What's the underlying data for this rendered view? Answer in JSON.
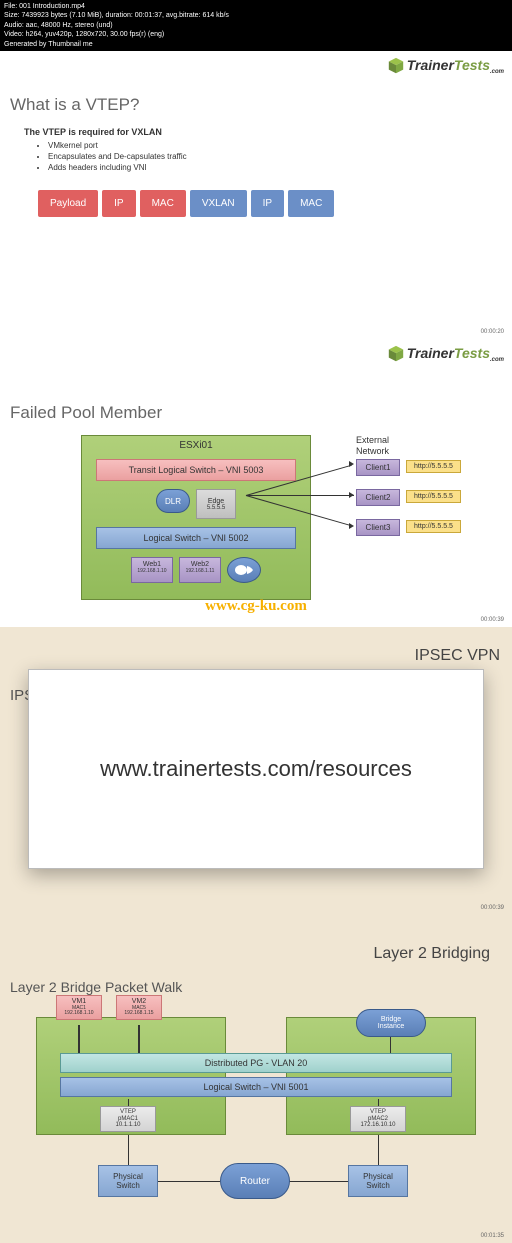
{
  "meta": {
    "line1": "File: 001 Introduction.mp4",
    "line2": "Size: 7439923 bytes (7.10 MiB), duration: 00:01:37, avg.bitrate: 614 kb/s",
    "line3": "Audio: aac, 48000 Hz, stereo (und)",
    "line4": "Video: h264, yuv420p, 1280x720, 30.00 fps(r) (eng)",
    "line5": "Generated by Thumbnail me"
  },
  "logo": {
    "trainer": "Trainer",
    "tests": "Tests",
    "com": ".com"
  },
  "slide1": {
    "title": "What is a VTEP?",
    "subtitle": "The VTEP is required for VXLAN",
    "bullets": [
      "VMkernel port",
      "Encapsulates and De-capsulates traffic",
      "Adds headers including VNI"
    ],
    "packets": [
      "Payload",
      "IP",
      "MAC",
      "VXLAN",
      "IP",
      "MAC"
    ],
    "timestamp": "00:00:20"
  },
  "slide2": {
    "title": "Failed Pool Member",
    "esxi": "ESXi01",
    "transit": "Transit Logical Switch – VNI 5003",
    "dlr": "DLR",
    "edge": "Edge",
    "edgeip": "5.5.5.5",
    "logical": "Logical Switch – VNI 5002",
    "web1": "Web1",
    "web1ip": "192.168.1.10",
    "web2": "Web2",
    "web2ip": "192.168.1.11",
    "external_label": "External\nNetwork",
    "clients": [
      "Client1",
      "Client2",
      "Client3"
    ],
    "http": "http://5.5.5.5",
    "watermark": "www.cg-ku.com",
    "timestamp": "00:00:39"
  },
  "slide3": {
    "right_title": "IPSEC VPN",
    "left_title": "IPSE",
    "overlay": "www.trainertests.com/resources",
    "timestamp": "00:00:39"
  },
  "slide4": {
    "right_title": "Layer 2 Bridging",
    "title": "Layer 2 Bridge Packet Walk",
    "vm1": "VM1",
    "vm1mac": "MAC1",
    "vm1ip": "192.168.1.10",
    "vm2": "VM2",
    "vm2mac": "MAC5",
    "vm2ip": "192.168.1.15",
    "bridge": "Bridge\nInstance",
    "dpg": "Distributed PG - VLAN 20",
    "ls": "Logical Switch – VNI 5001",
    "vtep1": "VTEP",
    "vtep1mac": "pMAC1",
    "vtep1ip": "10.1.1.10",
    "vtep2": "VTEP",
    "vtep2mac": "pMAC2",
    "vtep2ip": "172.16.10.10",
    "phys": "Physical\nSwitch",
    "router": "Router",
    "timestamp": "00:01:35"
  }
}
